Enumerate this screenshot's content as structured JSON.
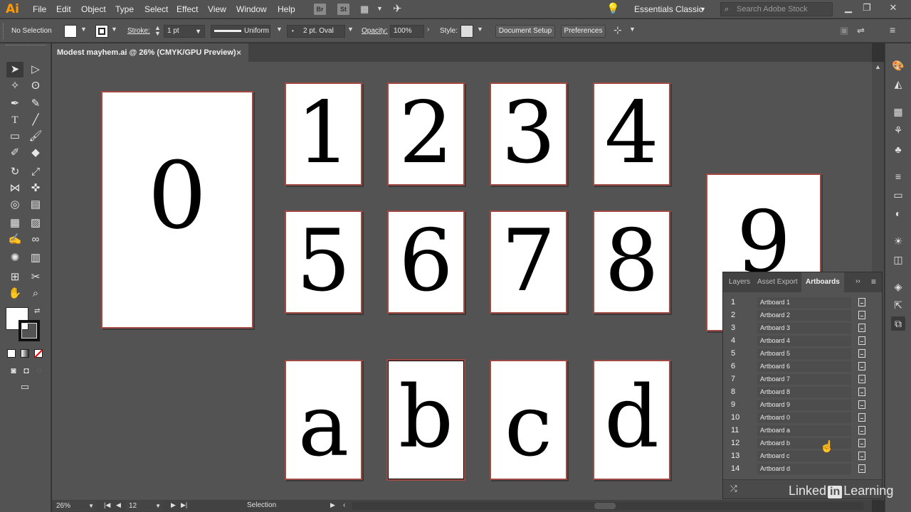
{
  "menubar": {
    "logo": "Ai",
    "menus": [
      "File",
      "Edit",
      "Object",
      "Type",
      "Select",
      "Effect",
      "View",
      "Window",
      "Help"
    ],
    "bridge_badge": "Br",
    "stock_badge": "St",
    "workspace": "Essentials Classic",
    "search_placeholder": "Search Adobe Stock"
  },
  "controlbar": {
    "selection": "No Selection",
    "stroke_label": "Stroke:",
    "stroke_weight": "1 pt",
    "stroke_profile": "Uniform",
    "brush": "2 pt. Oval",
    "opacity_label": "Opacity:",
    "opacity_value": "100%",
    "style_label": "Style:",
    "document_setup": "Document Setup",
    "preferences": "Preferences"
  },
  "document": {
    "tab_title": "Modest mayhem.ai @ 26% (CMYK/GPU Preview)",
    "close": "×"
  },
  "artboards_canvas": [
    "0",
    "1",
    "2",
    "3",
    "4",
    "5",
    "6",
    "7",
    "8",
    "9",
    "a",
    "b",
    "c",
    "d"
  ],
  "status": {
    "zoom": "26%",
    "artboard_number": "12",
    "tool": "Selection"
  },
  "panel": {
    "tabs": [
      "Layers",
      "Asset Export",
      "Artboards"
    ],
    "rows": [
      {
        "num": "1",
        "name": "Artboard 1"
      },
      {
        "num": "2",
        "name": "Artboard 2"
      },
      {
        "num": "3",
        "name": "Artboard 3"
      },
      {
        "num": "4",
        "name": "Artboard 4"
      },
      {
        "num": "5",
        "name": "Artboard 5"
      },
      {
        "num": "6",
        "name": "Artboard 6"
      },
      {
        "num": "7",
        "name": "Artboard 7"
      },
      {
        "num": "8",
        "name": "Artboard 8"
      },
      {
        "num": "9",
        "name": "Artboard 9"
      },
      {
        "num": "10",
        "name": "Artboard 0"
      },
      {
        "num": "11",
        "name": "Artboard a"
      },
      {
        "num": "12",
        "name": "Artboard b"
      },
      {
        "num": "13",
        "name": "Artboard c"
      },
      {
        "num": "14",
        "name": "Artboard d"
      }
    ]
  },
  "watermark": {
    "pre": "Linked",
    "in": "in",
    "post": "Learning"
  },
  "colors": {
    "accent": "#ff9a00",
    "artboard_border": "#a14a44"
  }
}
